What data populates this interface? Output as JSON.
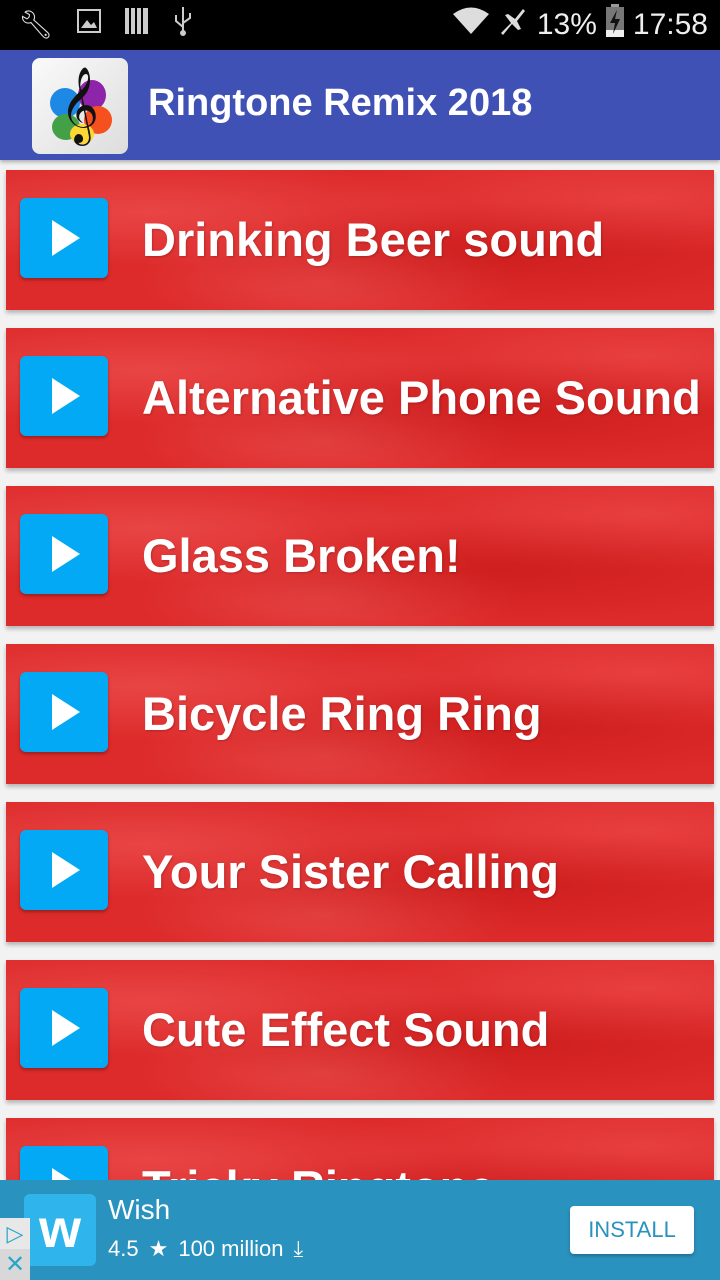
{
  "status_bar": {
    "left_icons": [
      "wrench-icon",
      "image-icon",
      "barcode-icon",
      "usb-icon"
    ],
    "wifi": "wifi-icon",
    "airplane": "airplane-icon",
    "battery_percent": "13%",
    "battery": "battery-charging-icon",
    "time": "17:58"
  },
  "app_bar": {
    "icon": "treble-clef-icon",
    "title": "Ringtone Remix 2018"
  },
  "list": {
    "items": [
      {
        "label": "Drinking Beer sound"
      },
      {
        "label": "Alternative Phone Sound"
      },
      {
        "label": "Glass Broken!"
      },
      {
        "label": "Bicycle Ring Ring"
      },
      {
        "label": "Your Sister Calling"
      },
      {
        "label": "Cute Effect Sound"
      },
      {
        "label": "Tricky Ringtone"
      }
    ]
  },
  "ad": {
    "app_name": "Wish",
    "logo_letter": "w",
    "rating": "4.5",
    "installs": "100 million",
    "install_label": "INSTALL",
    "adchoices_glyph": "▷",
    "close_glyph": "✕"
  },
  "colors": {
    "app_bar": "#3f51b5",
    "item_bg": "#dd2a2a",
    "play_button": "#03a9f4",
    "ad_bg": "#2a92bf"
  }
}
